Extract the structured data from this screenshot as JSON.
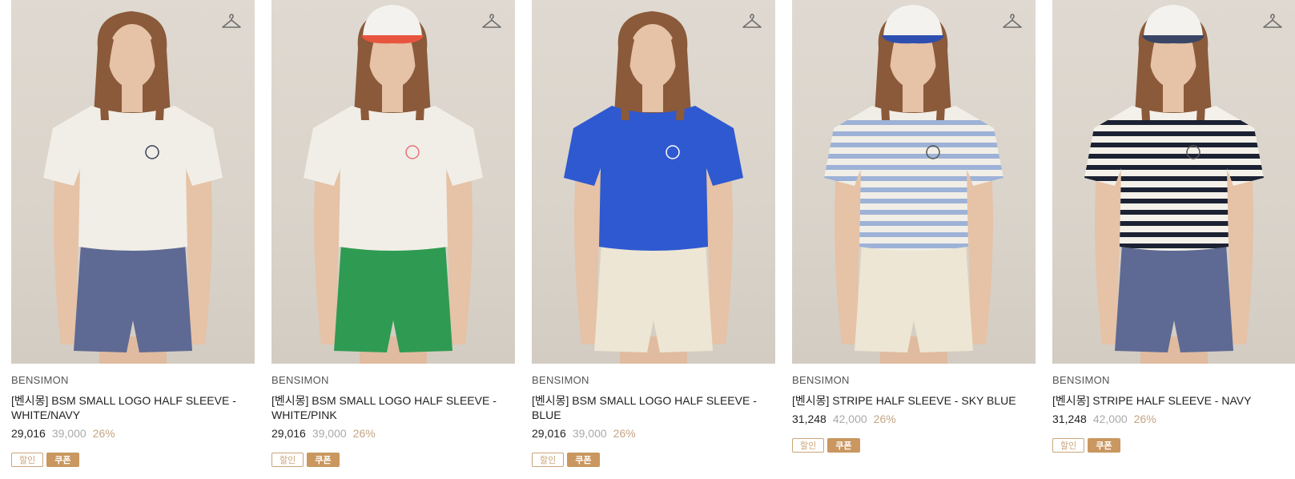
{
  "products": [
    {
      "brand": "BENSIMON",
      "name": "[벤시몽] BSM SMALL LOGO HALF SLEEVE - WHITE/NAVY",
      "price_sale": "29,016",
      "price_original": "39,000",
      "discount_rate": "26%",
      "tags": [
        "할인",
        "쿠폰"
      ],
      "shirt_color": "#f1eee7",
      "shirt_logo_color": "#3a3f55",
      "shorts_color": "#5e6a93",
      "cap": false,
      "cap_color": "",
      "stripes": ""
    },
    {
      "brand": "BENSIMON",
      "name": "[벤시몽] BSM SMALL LOGO HALF SLEEVE - WHITE/PINK",
      "price_sale": "29,016",
      "price_original": "39,000",
      "discount_rate": "26%",
      "tags": [
        "할인",
        "쿠폰"
      ],
      "shirt_color": "#f1eee7",
      "shirt_logo_color": "#e5737b",
      "shorts_color": "#2f9b52",
      "cap": true,
      "cap_color": "#e8553f",
      "stripes": ""
    },
    {
      "brand": "BENSIMON",
      "name": "[벤시몽] BSM SMALL LOGO HALF SLEEVE - BLUE",
      "price_sale": "29,016",
      "price_original": "39,000",
      "discount_rate": "26%",
      "tags": [
        "할인",
        "쿠폰"
      ],
      "shirt_color": "#2f59d0",
      "shirt_logo_color": "#ffffff",
      "shorts_color": "#ede6d4",
      "cap": false,
      "cap_color": "",
      "stripes": ""
    },
    {
      "brand": "BENSIMON",
      "name": "[벤시몽] STRIPE HALF SLEEVE - SKY BLUE",
      "price_sale": "31,248",
      "price_original": "42,000",
      "discount_rate": "26%",
      "tags": [
        "할인",
        "쿠폰"
      ],
      "shirt_color": "#f1eee7",
      "shirt_logo_color": "#555555",
      "shorts_color": "#ede6d4",
      "cap": true,
      "cap_color": "#2f4fb0",
      "stripes": "#9db2d6"
    },
    {
      "brand": "BENSIMON",
      "name": "[벤시몽] STRIPE HALF SLEEVE - NAVY",
      "price_sale": "31,248",
      "price_original": "42,000",
      "discount_rate": "26%",
      "tags": [
        "할인",
        "쿠폰"
      ],
      "shirt_color": "#f4f1ea",
      "shirt_logo_color": "#555555",
      "shorts_color": "#5e6a93",
      "cap": true,
      "cap_color": "#3a4666",
      "stripes": "#1c2233"
    }
  ],
  "colors": {
    "background": "#ffffff",
    "photo_background": "#dcd6ce",
    "discount_rate": "#c4a484",
    "tag_sale_border": "#c9a57a",
    "tag_coupon_bg": "#c9975f"
  },
  "icons": {
    "wishlist": "hanger-icon"
  }
}
